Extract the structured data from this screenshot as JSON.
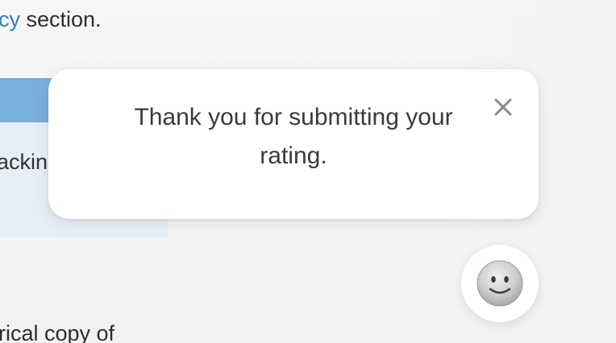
{
  "background": {
    "top_line": {
      "link_fragment": "cy",
      "text": " section."
    },
    "table_cell_fragment": "ackin",
    "bottom_line": "rical copy of"
  },
  "toast": {
    "message": "Thank you for submitting your rating.",
    "close_icon": "close-icon"
  },
  "feedback": {
    "icon": "slightly-smiling-face-icon"
  },
  "colors": {
    "link": "#2f7fc0",
    "table_header": "#7ab0de",
    "table_cell": "#e6eef8",
    "toast_bg": "#ffffff"
  }
}
